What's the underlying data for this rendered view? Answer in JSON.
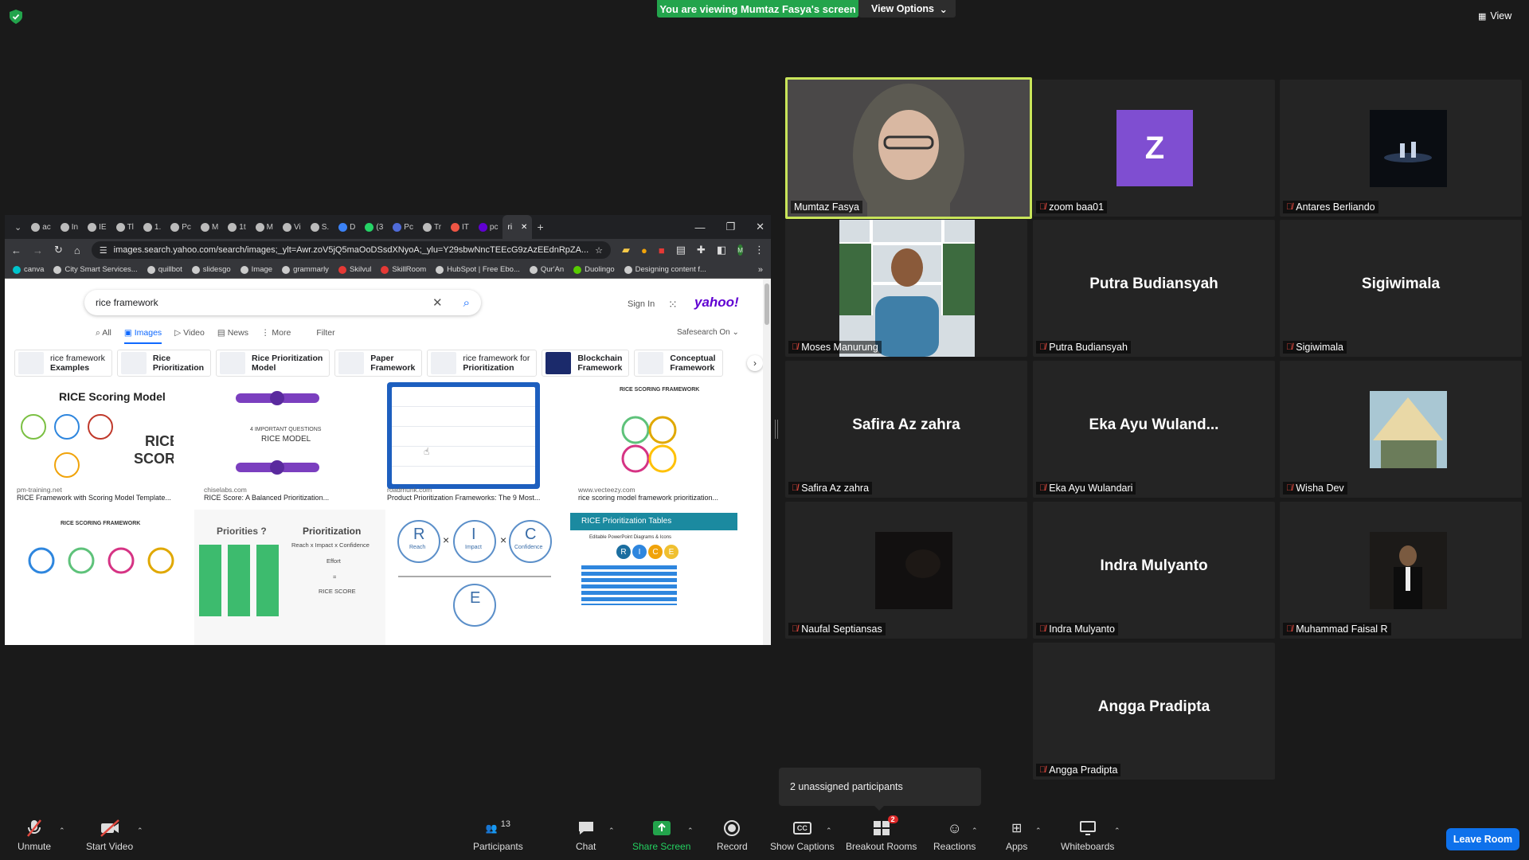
{
  "banner": {
    "text": "You are viewing Mumtaz Fasya's screen",
    "view_options": "View Options",
    "view_label": "View"
  },
  "browser": {
    "tabs": [
      "ac",
      "In",
      "IE",
      "Tl",
      "1.",
      "Pc",
      "M",
      "1t",
      "M",
      "Vi",
      "S.",
      "D",
      "(3",
      "Pc",
      "Tr",
      "IT",
      "pc",
      "ri"
    ],
    "url": "images.search.yahoo.com/search/images;_ylt=Awr.zoV5jQ5maOoDSsdXNyoA;_ylu=Y29sbwNncTEEcG9zAzEEdnRpZA...",
    "bookmarks": [
      "canva",
      "City Smart Services...",
      "quillbot",
      "slidesgo",
      "Image",
      "grammarly",
      "Skilvul",
      "SkillRoom",
      "HubSpot | Free Ebo...",
      "Qur'An",
      "Duolingo",
      "Designing content f..."
    ],
    "search_value": "rice framework",
    "sign_in": "Sign In",
    "logo": "yahoo!",
    "vertical_tabs": [
      "All",
      "Images",
      "Video",
      "News",
      "More",
      "Filter"
    ],
    "safesearch": "Safesearch On",
    "chips": [
      {
        "l1": "rice framework",
        "l2": "Examples"
      },
      {
        "l1": "Rice",
        "l2": "Prioritization"
      },
      {
        "l1": "Rice Prioritization",
        "l2": "Model"
      },
      {
        "l1": "Paper",
        "l2": "Framework"
      },
      {
        "l1": "rice framework for",
        "l2": "Prioritization"
      },
      {
        "l1": "Blockchain",
        "l2": "Framework"
      },
      {
        "l1": "Conceptual",
        "l2": "Framework"
      }
    ],
    "results": [
      {
        "source": "pm-training.net",
        "title": "RICE Framework with Scoring Model Template...",
        "img_title": "RICE Scoring Model",
        "img_sub1": "RICE",
        "img_sub2": "SCORE"
      },
      {
        "source": "chiselabs.com",
        "title": "RICE Score: A Balanced Prioritization...",
        "img_title": "4 IMPORTANT QUESTIONS",
        "img_sub1": "RICE MODEL"
      },
      {
        "source": "roadmunk.com",
        "title": "Product Prioritization Frameworks: The 9 Most..."
      },
      {
        "source": "www.vecteezy.com",
        "title": "rice scoring model framework prioritization...",
        "img_title": "RICE SCORING FRAMEWORK"
      }
    ],
    "row2": {
      "a_title": "RICE SCORING FRAMEWORK",
      "b_title": "Priorities ?",
      "b_title2": "Prioritization",
      "b_formula": "Reach x Impact x Confidence",
      "b_effort": "Effort",
      "b_eq": "=",
      "b_score": "RICE SCORE",
      "c_letters": [
        "R",
        "I",
        "C",
        "E"
      ],
      "c_words": [
        "Reach",
        "Impact",
        "Confidence"
      ],
      "d_title": "RICE Prioritization Tables",
      "d_sub": "Editable PowerPoint Diagrams & Icons",
      "rice_letters": [
        "R",
        "I",
        "C",
        "E"
      ]
    }
  },
  "participants": [
    {
      "name": "Mumtaz Fasya",
      "muted": false
    },
    {
      "name": "zoom baa01",
      "muted": true,
      "avatar": "Z"
    },
    {
      "name": "Antares Berliando",
      "muted": true
    },
    {
      "name": "Moses Manurung",
      "muted": true
    },
    {
      "name": "Putra Budiansyah",
      "muted": true,
      "big": "Putra Budiansyah"
    },
    {
      "name": "Sigiwimala",
      "muted": true,
      "big": "Sigiwimala"
    },
    {
      "name": "Safira Az zahra",
      "muted": true,
      "big": "Safira Az zahra"
    },
    {
      "name": "Eka Ayu Wulandari",
      "muted": true,
      "big": "Eka Ayu Wuland..."
    },
    {
      "name": "Wisha Dev",
      "muted": true
    },
    {
      "name": "Naufal Septiansas",
      "muted": true
    },
    {
      "name": "Indra Mulyanto",
      "muted": true,
      "big": "Indra Mulyanto"
    },
    {
      "name": "Muhammad Faisal R",
      "muted": true
    },
    {
      "name": "Angga Pradipta",
      "muted": true,
      "big": "Angga Pradipta"
    }
  ],
  "unassigned": "2 unassigned participants",
  "toolbar": {
    "unmute": "Unmute",
    "start_video": "Start Video",
    "participants": "Participants",
    "participants_count": "13",
    "chat": "Chat",
    "share_screen": "Share Screen",
    "record": "Record",
    "captions": "Show Captions",
    "captions_icon": "CC",
    "breakout": "Breakout Rooms",
    "breakout_badge": "2",
    "reactions": "Reactions",
    "apps": "Apps",
    "whiteboards": "Whiteboards",
    "leave": "Leave Room"
  },
  "colors": {
    "share_green": "#23a44c",
    "speaker_border": "#c9e55a",
    "leave_blue": "#0e71eb",
    "muted_red": "#e0483e",
    "avatar_purple": "#7f4ed1"
  }
}
